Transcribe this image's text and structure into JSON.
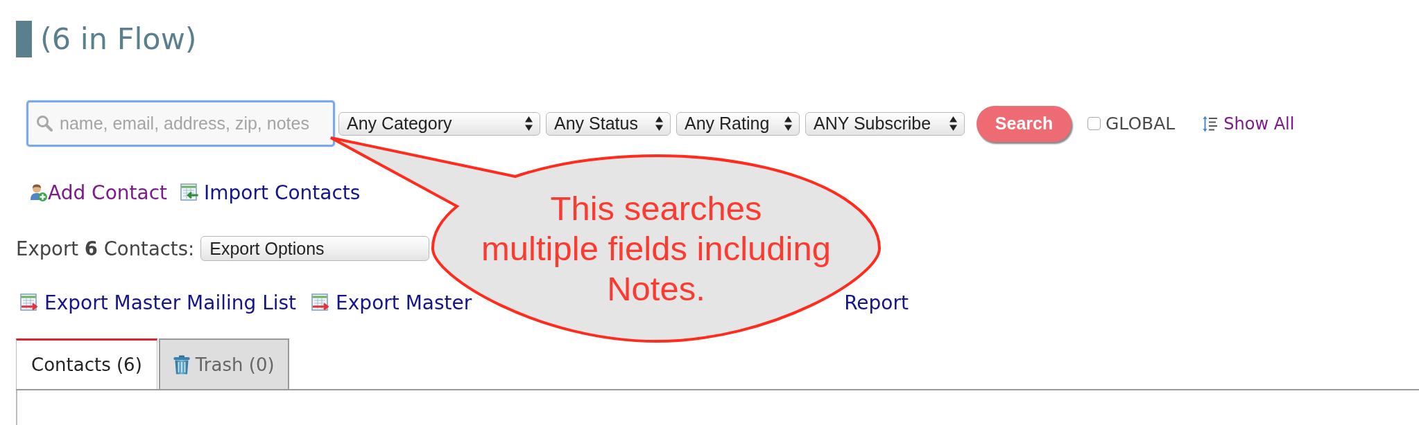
{
  "header": {
    "title": "(6 in Flow)"
  },
  "search_bar": {
    "search_field": {
      "placeholder": "name, email, address, zip, notes",
      "focused": true
    },
    "filters": [
      {
        "value": "Any Category"
      },
      {
        "value": "Any Status"
      },
      {
        "value": "Any Rating"
      },
      {
        "value": "ANY Subscribe"
      }
    ],
    "search_button": {
      "label": "Search"
    },
    "global_checkbox": {
      "label": "GLOBAL",
      "checked": false
    },
    "show_all": {
      "label": "Show All",
      "visited": true
    }
  },
  "actions": [
    {
      "kind": "add",
      "label": "Add Contact",
      "visited": true
    },
    {
      "kind": "import",
      "label": "Import Contacts",
      "visited": false
    }
  ],
  "export": {
    "label": "Export **6** Contacts:",
    "select": {
      "value": "Export Options"
    }
  },
  "export_links": [
    {
      "label": "Export Master Mailing List",
      "icon": true
    },
    {
      "label": "Export Master",
      "icon": true
    },
    {
      "label": "Report",
      "icon": false
    }
  ],
  "tabs": [
    {
      "kind": "plain",
      "label": "Contacts (6)",
      "selected": true
    },
    {
      "kind": "trash",
      "label": "Trash (0)",
      "selected": false
    }
  ],
  "callout": {
    "text": "This searches\nmultiple fields including\nNotes."
  }
}
